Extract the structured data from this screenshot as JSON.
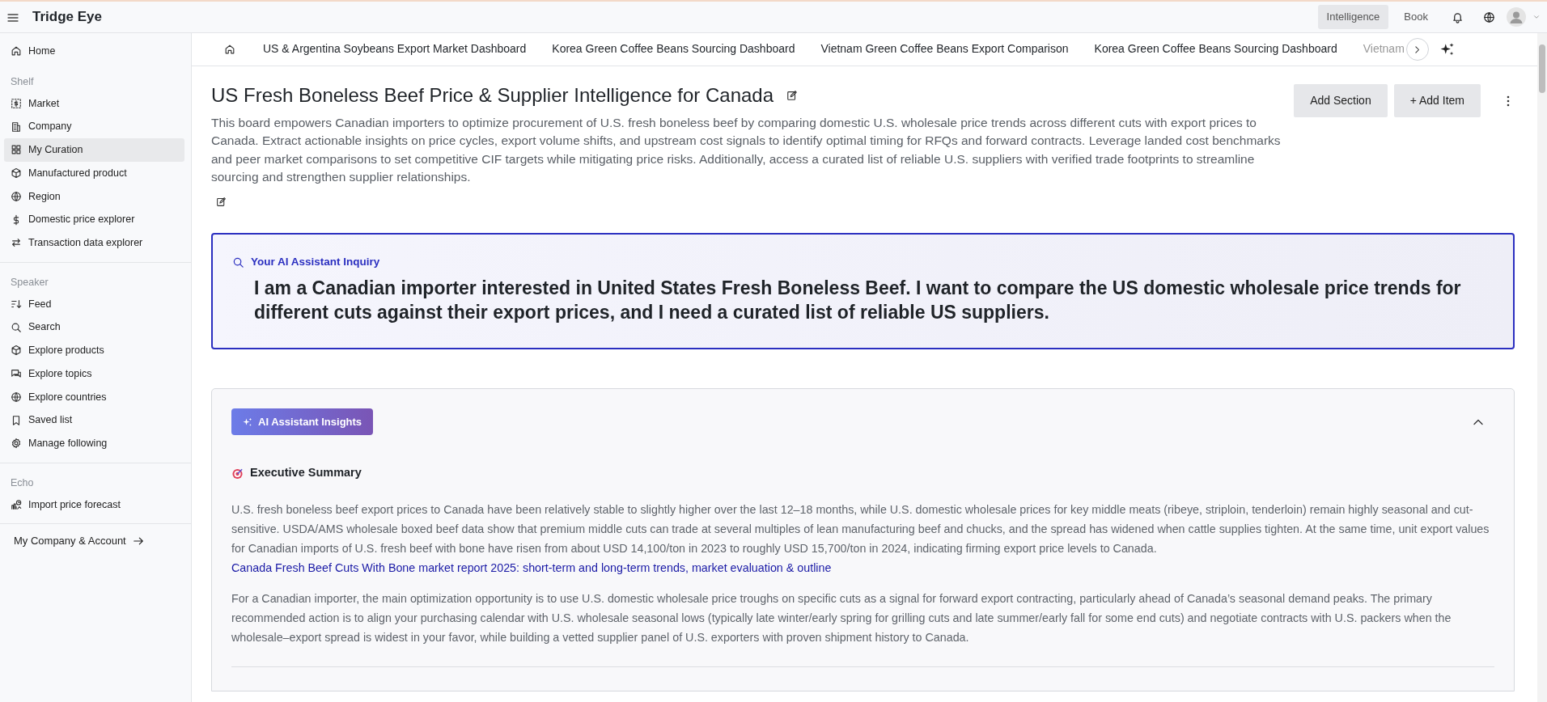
{
  "app": {
    "title": "Tridge Eye"
  },
  "top_nav": [
    {
      "label": "Intelligence",
      "selected": true
    },
    {
      "label": "Book",
      "selected": false
    }
  ],
  "sidebar": {
    "home": {
      "label": "Home",
      "selected": false
    },
    "sections": [
      {
        "heading": "Shelf",
        "items": [
          {
            "label": "Market",
            "selected": false
          },
          {
            "label": "Company",
            "selected": false
          },
          {
            "label": "My Curation",
            "selected": true
          },
          {
            "label": "Manufactured product",
            "selected": false
          },
          {
            "label": "Region",
            "selected": false
          },
          {
            "label": "Domestic price explorer",
            "selected": false
          },
          {
            "label": "Transaction data explorer",
            "selected": false
          }
        ]
      },
      {
        "heading": "Speaker",
        "items": [
          {
            "label": "Feed",
            "selected": false
          },
          {
            "label": "Search",
            "selected": false
          },
          {
            "label": "Explore products",
            "selected": false
          },
          {
            "label": "Explore topics",
            "selected": false
          },
          {
            "label": "Explore countries",
            "selected": false
          },
          {
            "label": "Saved list",
            "selected": false
          },
          {
            "label": "Manage following",
            "selected": false
          }
        ]
      },
      {
        "heading": "Echo",
        "items": [
          {
            "label": "Import price forecast",
            "selected": false
          }
        ]
      }
    ],
    "account_link": "My Company & Account"
  },
  "tabs": [
    {
      "label": "US & Argentina Soybeans Export Market Dashboard",
      "selected": false
    },
    {
      "label": "Korea Green Coffee Beans Sourcing Dashboard",
      "selected": false
    },
    {
      "label": "Vietnam Green Coffee Beans Export Comparison",
      "selected": false
    },
    {
      "label": "Korea Green Coffee Beans Sourcing Dashboard",
      "selected": false
    },
    {
      "label": "Vietnam",
      "selected": false
    }
  ],
  "board": {
    "title": "US Fresh Boneless Beef Price & Supplier Intelligence for Canada",
    "description": "This board empowers Canadian importers to optimize procurement of U.S. fresh boneless beef by comparing domestic U.S. wholesale price trends across different cuts with export prices to Canada. Extract actionable insights on price cycles, export volume shifts, and upstream cost signals to identify optimal timing for RFQs and forward contracts. Leverage landed cost benchmarks and peer market comparisons to set competitive CIF targets while mitigating price risks. Additionally, access a curated list of reliable U.S. suppliers with verified trade footprints to streamline sourcing and strengthen supplier relationships.",
    "buttons": [
      "Add Section",
      "+ Add Item"
    ]
  },
  "inquiry": {
    "label": "Your AI Assistant Inquiry",
    "text": "I am a Canadian importer interested in United States Fresh Boneless Beef. I want to compare the US domestic wholesale price trends for different cuts against their export prices, and I need a curated list of reliable US suppliers."
  },
  "insights": {
    "badge": "AI Assistant Insights",
    "expanded": true,
    "heading": "Executive Summary",
    "paragraphs": [
      {
        "text": "U.S. fresh boneless beef export prices to Canada have been relatively stable to slightly higher over the last 12–18 months, while U.S. domestic wholesale prices for key middle meats (ribeye, striploin, tenderloin) remain highly seasonal and cut-sensitive. USDA/AMS wholesale boxed beef data show that premium middle cuts can trade at several multiples of lean manufacturing beef and chucks, and the spread has widened when cattle supplies tighten. At the same time, unit export values for Canadian imports of U.S. fresh beef with bone have risen from about USD 14,100/ton in 2023 to roughly USD 15,700/ton in 2024, indicating firming export price levels to Canada.",
        "link": "Canada Fresh Beef Cuts With Bone market report 2025: short-term and long-term trends, market evaluation & outline"
      },
      {
        "text": "For a Canadian importer, the main optimization opportunity is to use U.S. domestic wholesale price troughs on specific cuts as a signal for forward export contracting, particularly ahead of Canada’s seasonal demand peaks. The primary recommended action is to align your purchasing calendar with U.S. wholesale seasonal lows (typically late winter/early spring for grilling cuts and late summer/early fall for some end cuts) and negotiate contracts with U.S. packers when the wholesale–export spread is widest in your favor, while building a vetted supplier panel of U.S. exporters with proven shipment history to Canada."
      }
    ]
  }
}
